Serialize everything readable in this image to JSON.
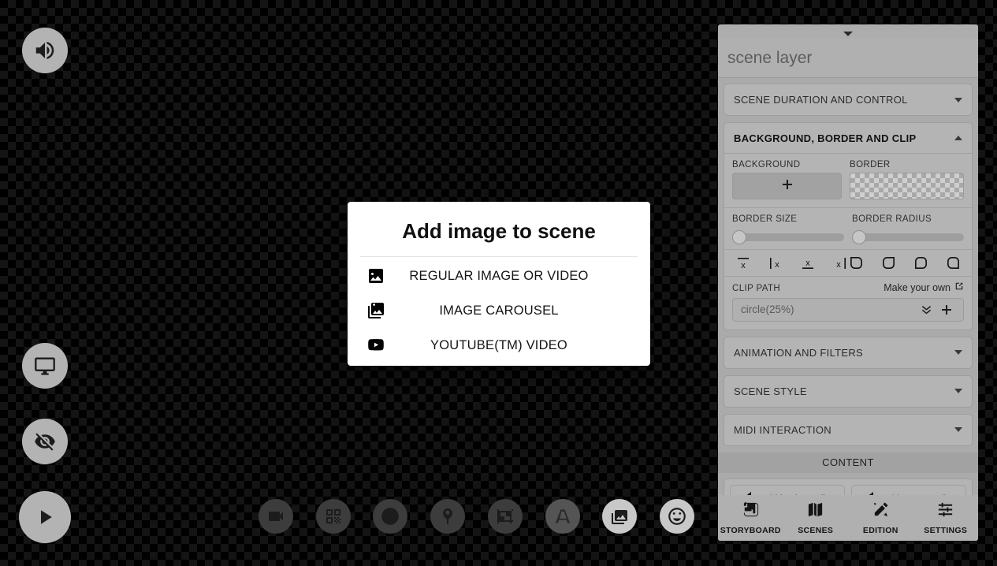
{
  "canvas": {
    "background_color": "#000000",
    "checker_color": "#141414"
  },
  "left_toolbar": {
    "items": [
      {
        "name": "audio-icon",
        "label": "Audio"
      },
      {
        "name": "screen-icon",
        "label": "Screen"
      },
      {
        "name": "hidden-icon",
        "label": "Hidden"
      }
    ],
    "play_label": "Play"
  },
  "bottom_toolbar": {
    "items": [
      {
        "name": "video-camera-icon",
        "label": "Video",
        "state": "dim"
      },
      {
        "name": "qr-code-icon",
        "label": "QR Code",
        "state": "dim"
      },
      {
        "name": "clock-icon",
        "label": "Timer",
        "state": "dim"
      },
      {
        "name": "pin-icon",
        "label": "Marker",
        "state": "dim"
      },
      {
        "name": "shapes-icon",
        "label": "Shapes",
        "state": "dim"
      },
      {
        "name": "text-icon",
        "label": "Text",
        "state": "mid"
      },
      {
        "name": "image-icon",
        "label": "Image",
        "state": "active"
      },
      {
        "name": "emoji-icon",
        "label": "Emoji",
        "state": "active"
      }
    ]
  },
  "dialog": {
    "title": "Add image to scene",
    "options": [
      {
        "icon": "image-icon",
        "label": "REGULAR IMAGE OR VIDEO"
      },
      {
        "icon": "image-carousel-icon",
        "label": "IMAGE CAROUSEL"
      },
      {
        "icon": "youtube-icon",
        "label": "YOUTUBE(TM) VIDEO"
      }
    ]
  },
  "panel": {
    "title": "scene layer",
    "menu_label": "More options",
    "sections": [
      {
        "key": "duration",
        "label": "SCENE DURATION AND CONTROL",
        "open": false
      },
      {
        "key": "background",
        "label": "BACKGROUND, BORDER AND CLIP",
        "open": true
      },
      {
        "key": "animation",
        "label": "ANIMATION AND FILTERS",
        "open": false
      },
      {
        "key": "style",
        "label": "SCENE STYLE",
        "open": false
      },
      {
        "key": "midi",
        "label": "MIDI INTERACTION",
        "open": false
      }
    ],
    "background_section": {
      "background_label": "BACKGROUND",
      "background_add_label": "+",
      "border_label": "BORDER",
      "border_size_label": "BORDER SIZE",
      "border_size_value": 0,
      "border_radius_label": "BORDER RADIUS",
      "border_radius_value": 0,
      "flip_icons": [
        "flip-vertical-top-icon",
        "flip-horizontal-left-icon",
        "flip-vertical-bottom-icon",
        "flip-horizontal-right-icon"
      ],
      "corner_icons": [
        "corner-radius-top-left-icon",
        "corner-radius-top-right-icon",
        "corner-radius-bottom-left-icon",
        "corner-radius-bottom-right-icon"
      ],
      "clip_path_label": "CLIP PATH",
      "make_your_own_label": "Make your own",
      "clip_path_value": "circle(25%)",
      "clip_path_placeholder": "circle(25%)"
    },
    "content_bar_label": "CONTENT",
    "content_buttons": [
      {
        "label": "add basic media",
        "icon": "back-arrow-icon"
      },
      {
        "label": "add extra media",
        "icon": "back-arrow-icon"
      }
    ],
    "nav": [
      {
        "name": "storyboard",
        "label": "STORYBOARD",
        "icon": "scroll-icon",
        "active": true
      },
      {
        "name": "scenes",
        "label": "SCENES",
        "icon": "map-icon",
        "active": false
      },
      {
        "name": "edition",
        "label": "EDITION",
        "icon": "pencil-ruler-icon",
        "active": false
      },
      {
        "name": "settings",
        "label": "SETTINGS",
        "icon": "sliders-icon",
        "active": false
      }
    ]
  }
}
